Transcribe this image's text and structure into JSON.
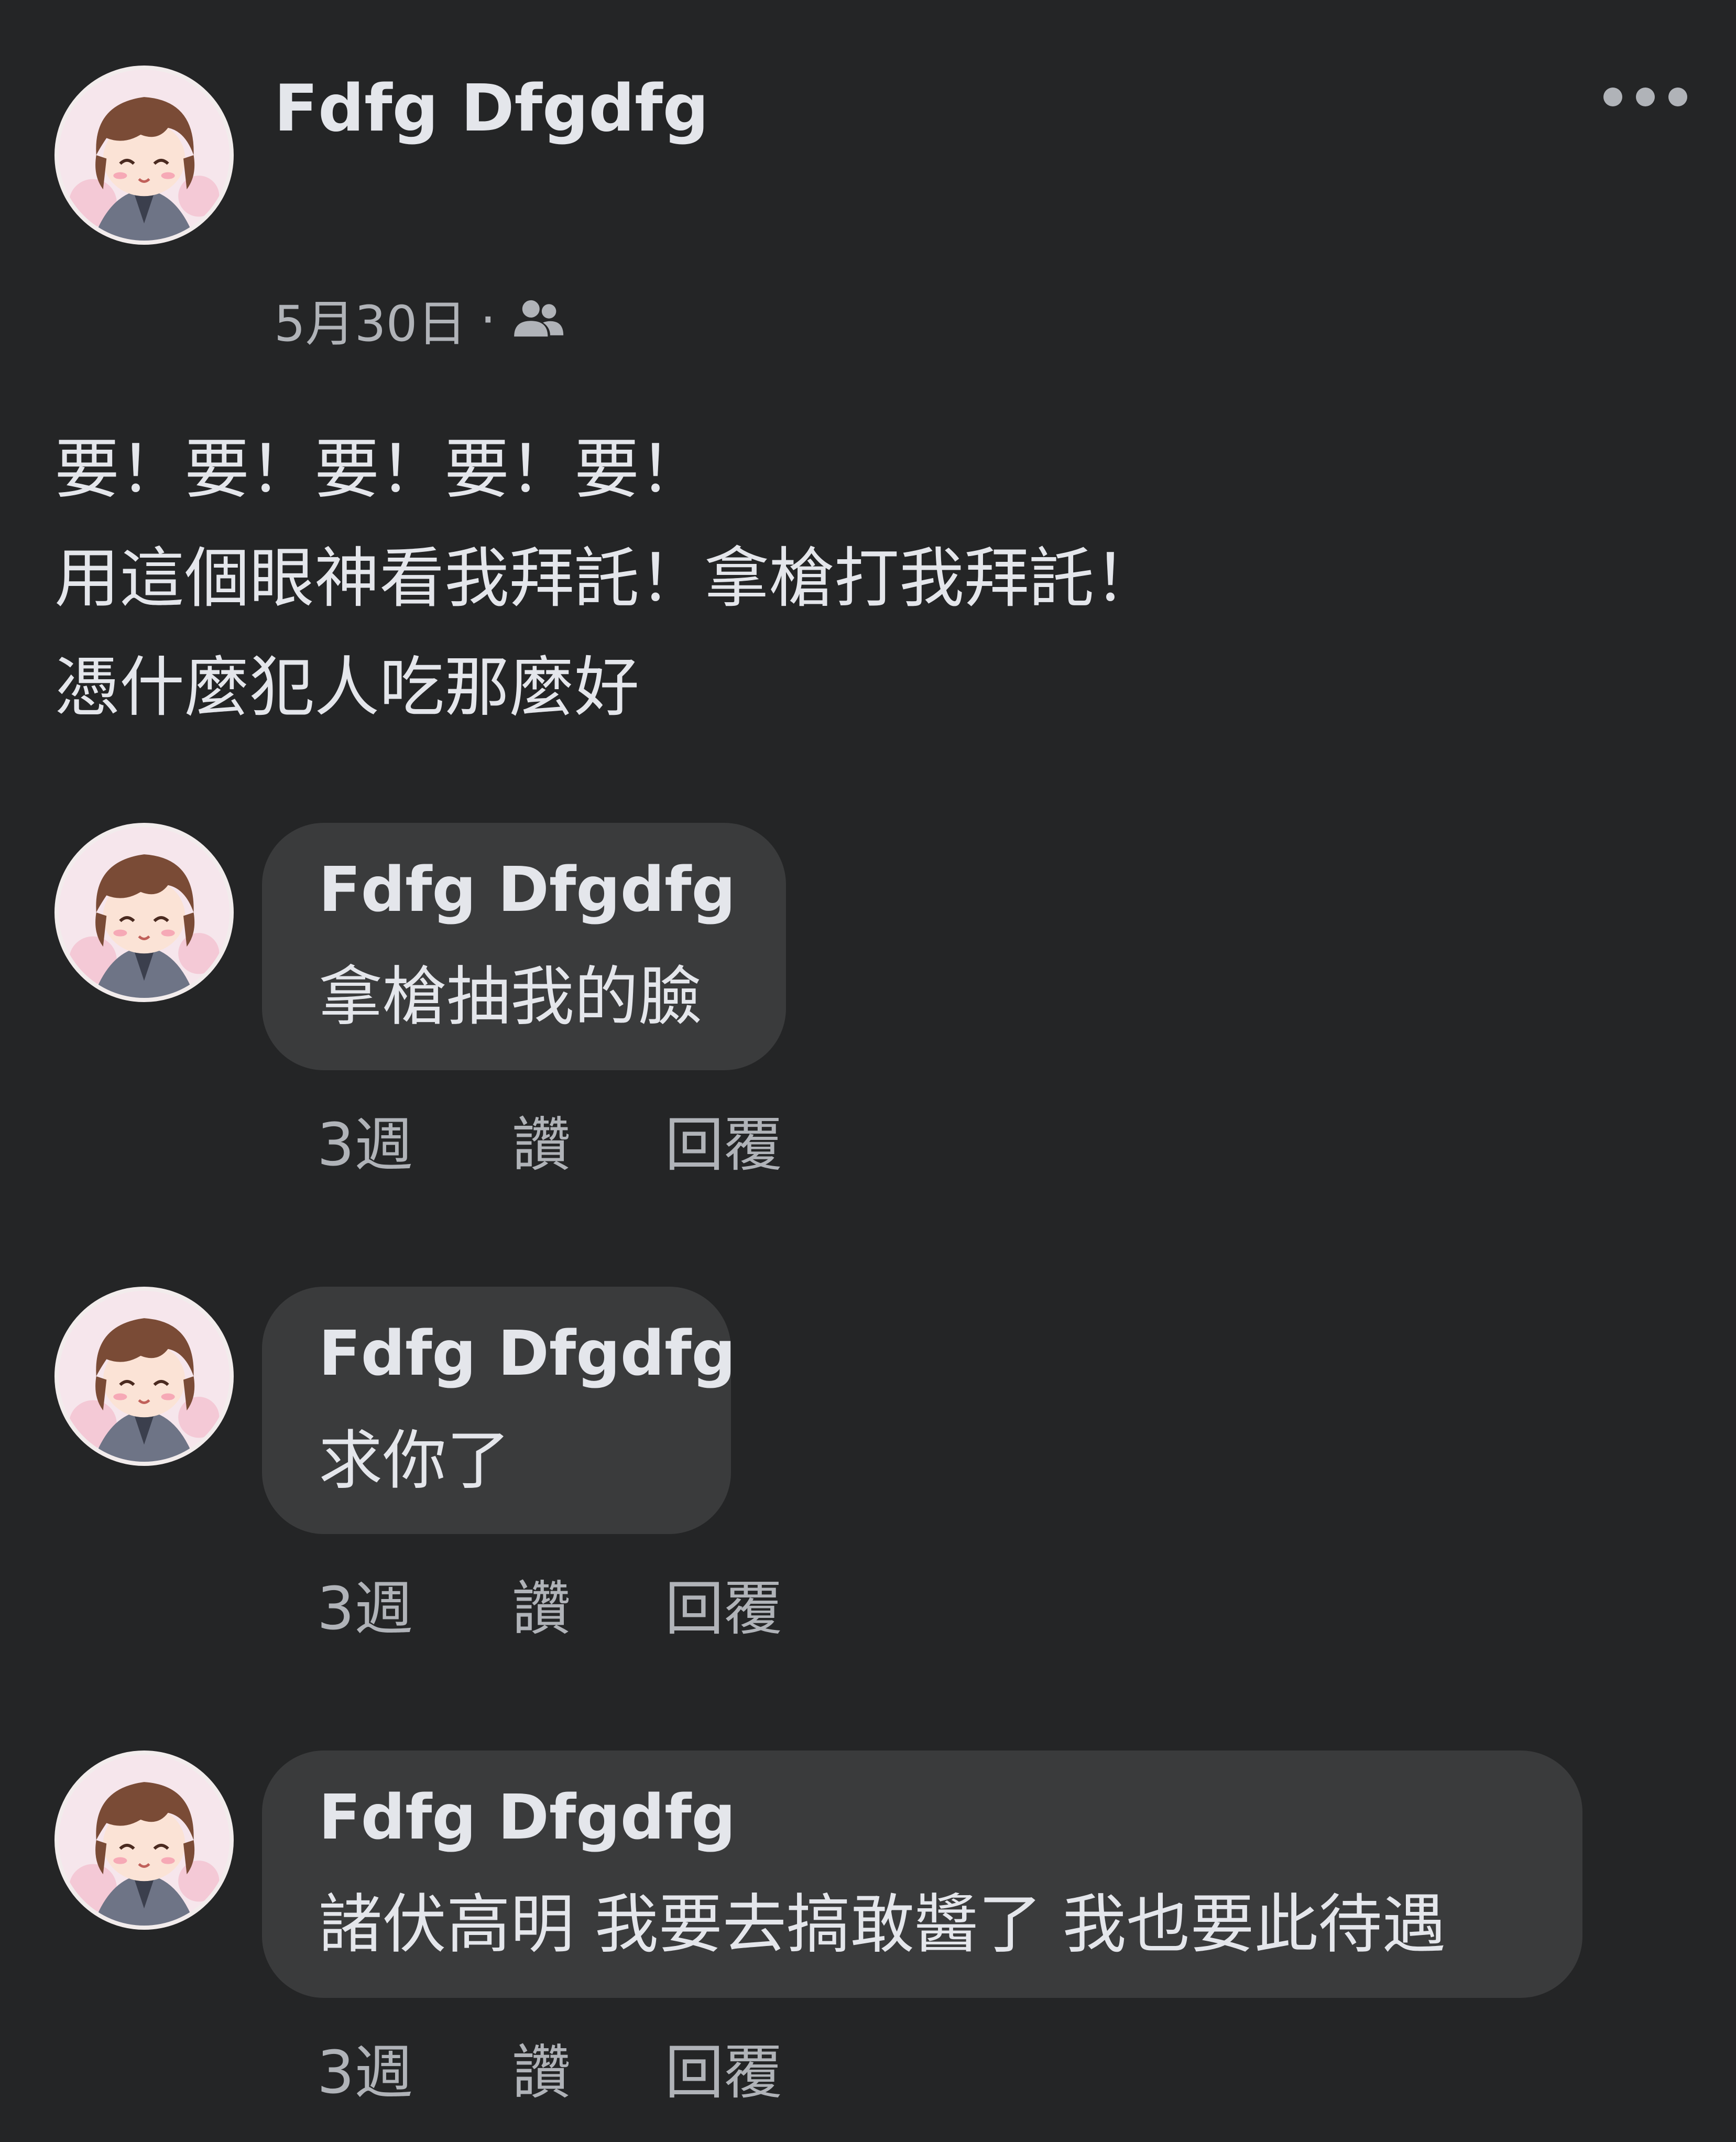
{
  "post": {
    "author": "Fdfg Dfgdfg",
    "date": "5月30日",
    "separator": "·",
    "audience_icon": "friends-icon",
    "more_icon": "more-options-icon",
    "lines": [
      "要！要！要！要！要！",
      "用這個眼神看我拜託！拿槍打我拜託！",
      "憑什麼犯人吃那麼好"
    ]
  },
  "comments": [
    {
      "author": "Fdfg Dfgdfg",
      "text": "拿槍抽我的臉",
      "time": "3週",
      "like_label": "讚",
      "reply_label": "回覆"
    },
    {
      "author": "Fdfg Dfgdfg",
      "text": "求你了",
      "time": "3週",
      "like_label": "讚",
      "reply_label": "回覆"
    },
    {
      "author": "Fdfg Dfgdfg",
      "text": "諸伏高明 我要去搞敢醬了 我也要此待遇",
      "time": "3週",
      "like_label": "讚",
      "reply_label": "回覆"
    }
  ],
  "colors": {
    "background": "#242526",
    "bubble": "#3a3b3c",
    "primary_text": "#e4e6eb",
    "secondary_text": "#b0b3b8"
  }
}
